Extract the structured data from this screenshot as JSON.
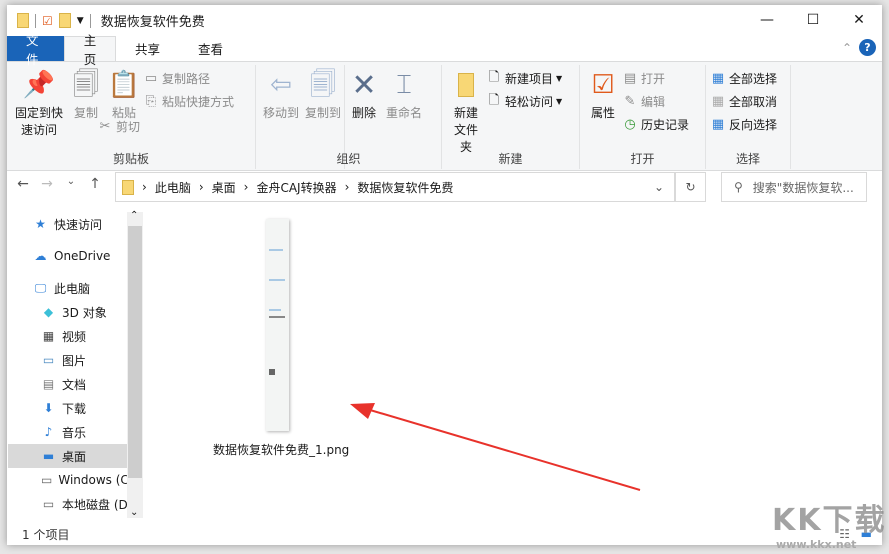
{
  "window": {
    "title": "数据恢复软件免费",
    "minimize": "—",
    "maximize": "☐",
    "close": "✕"
  },
  "tabs": [
    "文件",
    "主页",
    "共享",
    "查看"
  ],
  "ribbon": {
    "clipboard": {
      "label": "剪贴板",
      "pin": "固定到快速访问",
      "copy": "复制",
      "paste": "粘贴",
      "copy_path": "复制路径",
      "paste_shortcut": "粘贴快捷方式",
      "cut": "剪切"
    },
    "organize": {
      "label": "组织",
      "move_to": "移动到",
      "copy_to": "复制到",
      "delete": "删除",
      "rename": "重命名"
    },
    "new": {
      "label": "新建",
      "new_folder": "新建文件夹",
      "new_item": "新建项目",
      "easy_access": "轻松访问"
    },
    "open": {
      "label": "打开",
      "properties": "属性",
      "open": "打开",
      "edit": "编辑",
      "history": "历史记录"
    },
    "select": {
      "label": "选择",
      "select_all": "全部选择",
      "select_none": "全部取消",
      "invert": "反向选择"
    }
  },
  "address": {
    "crumbs": [
      "此电脑",
      "桌面",
      "金舟CAJ转换器",
      "数据恢复软件免费"
    ],
    "search_placeholder": "搜索\"数据恢复软..."
  },
  "nav_pane": [
    {
      "label": "快速访问",
      "icon": "star-icon",
      "sub": false
    },
    {
      "label": "OneDrive",
      "icon": "cloud-icon",
      "sub": false
    },
    {
      "label": "此电脑",
      "icon": "computer-icon",
      "sub": false
    },
    {
      "label": "3D 对象",
      "icon": "cube-icon",
      "sub": true
    },
    {
      "label": "视频",
      "icon": "video-icon",
      "sub": true
    },
    {
      "label": "图片",
      "icon": "picture-icon",
      "sub": true
    },
    {
      "label": "文档",
      "icon": "document-icon",
      "sub": true
    },
    {
      "label": "下载",
      "icon": "download-icon",
      "sub": true
    },
    {
      "label": "音乐",
      "icon": "music-icon",
      "sub": true
    },
    {
      "label": "桌面",
      "icon": "desktop-icon",
      "sub": true,
      "selected": true
    },
    {
      "label": "Windows (C",
      "icon": "drive-icon",
      "sub": true
    },
    {
      "label": "本地磁盘 (D",
      "icon": "drive-icon",
      "sub": true
    }
  ],
  "file": {
    "name": "数据恢复软件免费_1.png"
  },
  "status": {
    "count": "1 个项目"
  },
  "watermark": {
    "text": "KK下载",
    "url": "www.kkx.net"
  },
  "colors": {
    "accent": "#1a64b8",
    "arrow": "#e8322b"
  }
}
